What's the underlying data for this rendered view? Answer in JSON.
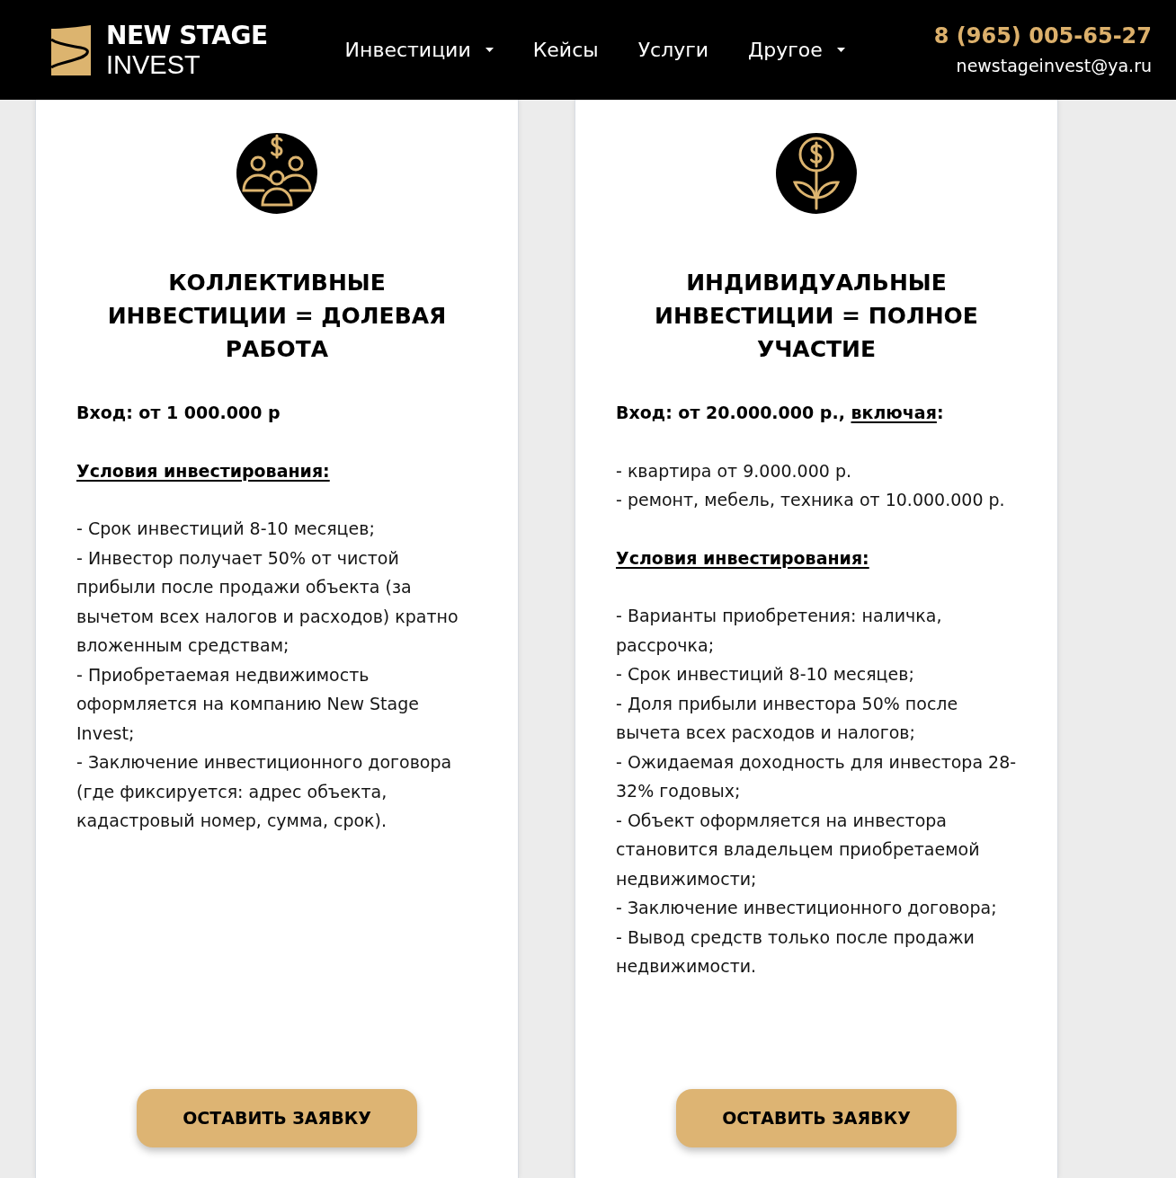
{
  "header": {
    "logo": {
      "line_1": "NEW STAGE",
      "line_2": "INVEST"
    },
    "nav": [
      {
        "label": "Инвестиции",
        "dropdown": true
      },
      {
        "label": "Кейсы",
        "dropdown": false
      },
      {
        "label": "Услуги",
        "dropdown": false
      },
      {
        "label": "Другое",
        "dropdown": true
      }
    ],
    "phone": "8 (965) 005-65-27",
    "email": "newstageinvest@ya.ru"
  },
  "cards": [
    {
      "kind": "collective",
      "title": "КОЛЛЕКТИВНЫЕ ИНВЕСТИЦИИ = ДОЛЕВАЯ РАБОТА",
      "blocks": [
        {
          "kind": "entry",
          "segments": [
            {
              "text": "Вход: от 1 000.000 р",
              "underline": false
            }
          ]
        },
        {
          "kind": "heading",
          "text": "Условия инвестирования:"
        },
        {
          "kind": "list",
          "items": [
            "- Срок инвестиций 8-10 месяцев;",
            "- Инвестор получает 50% от чистой прибыли после продажи объекта (за вычетом всех налогов и расходов) кратно вложенным средствам;",
            "- Приобретаемая недвижимость оформляется на компанию New Stage Invest;",
            "- Заключение инвестиционного договора (где фиксируется: адрес объекта, кадастровый номер, сумма, срок)."
          ]
        }
      ],
      "button": "ОСТАВИТЬ ЗАЯВКУ"
    },
    {
      "kind": "individual",
      "title": "ИНДИВИДУАЛЬНЫЕ ИНВЕСТИЦИИ = ПОЛНОЕ УЧАСТИЕ",
      "blocks": [
        {
          "kind": "entry",
          "segments": [
            {
              "text": "Вход: от 20.000.000 р., ",
              "underline": false
            },
            {
              "text": "включая",
              "underline": true
            },
            {
              "text": ":",
              "underline": false
            }
          ]
        },
        {
          "kind": "list",
          "items": [
            "- квартира от 9.000.000 р.",
            "- ремонт, мебель, техника от 10.000.000 р."
          ]
        },
        {
          "kind": "heading",
          "text": "Условия инвестирования:"
        },
        {
          "kind": "list",
          "items": [
            "- Варианты приобретения: наличка, рассрочка;",
            "- Срок инвестиций 8-10 месяцев;",
            "- Доля прибыли инвестора 50% после вычета всех расходов и налогов;",
            "- Ожидаемая доходность для инвестора 28-32% годовых;",
            "- Объект оформляется на инвестора становится владельцем приобретаемой недвижимости;",
            "- Заключение инвестиционного договора;",
            "- Вывод средств только после продажи недвижимости."
          ]
        }
      ],
      "button": "ОСТАВИТЬ ЗАЯВКУ"
    }
  ]
}
